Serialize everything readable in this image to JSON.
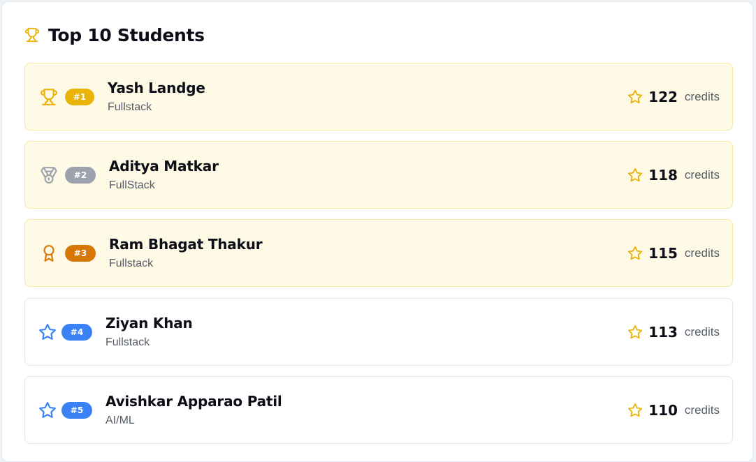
{
  "header": {
    "title": "Top 10 Students",
    "icon": "trophy-icon"
  },
  "colors": {
    "gold": "#eab308",
    "silver": "#9ca3af",
    "bronze": "#d97706",
    "blue": "#3b82f6",
    "star": "#eab308"
  },
  "students": [
    {
      "rank": "#1",
      "name": "Yash Landge",
      "track": "Fullstack",
      "credits": "122",
      "unit": "credits",
      "icon": "trophy-icon"
    },
    {
      "rank": "#2",
      "name": "Aditya Matkar",
      "track": "FullStack",
      "credits": "118",
      "unit": "credits",
      "icon": "medal-icon"
    },
    {
      "rank": "#3",
      "name": "Ram Bhagat Thakur",
      "track": "Fullstack",
      "credits": "115",
      "unit": "credits",
      "icon": "award-icon"
    },
    {
      "rank": "#4",
      "name": "Ziyan Khan",
      "track": "Fullstack",
      "credits": "113",
      "unit": "credits",
      "icon": "star-icon"
    },
    {
      "rank": "#5",
      "name": "Avishkar Apparao Patil",
      "track": "AI/ML",
      "credits": "110",
      "unit": "credits",
      "icon": "star-icon"
    }
  ]
}
